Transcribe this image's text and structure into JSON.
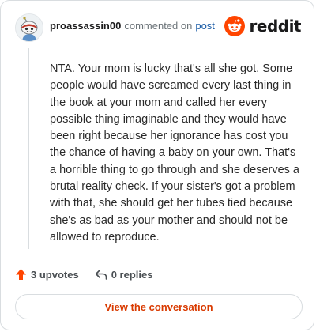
{
  "comment": {
    "username": "proassassin00",
    "action_text": "commented on",
    "post_link": "post",
    "body": "NTA. Your mom is lucky that's all she got. Some people would have screamed every last thing in the book at your mom and called her every possible thing imaginable and they would have been right because her ignorance has cost you the chance of having a baby on your own. That's a horrible thing to go through and she deserves a brutal reality check. If your sister's got a problem with that, she should get her tubes tied because she's as bad as your mother and should not be allowed to reproduce."
  },
  "brand": {
    "name": "reddit",
    "accent": "#ff4500"
  },
  "stats": {
    "upvotes_label": "3 upvotes",
    "replies_label": "0 replies"
  },
  "cta": {
    "label": "View the conversation"
  },
  "icons": {
    "avatar": "snoo-avatar-icon",
    "logo": "reddit-logo-icon",
    "upvote": "upvote-arrow-icon",
    "reply": "reply-arrow-icon"
  }
}
